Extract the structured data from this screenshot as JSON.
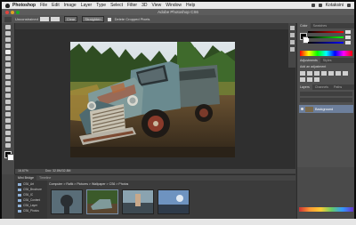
{
  "menubar": {
    "items": [
      "Photoshop",
      "File",
      "Edit",
      "Image",
      "Layer",
      "Type",
      "Select",
      "Filter",
      "3D",
      "View",
      "Window",
      "Help"
    ],
    "user": "Kotaksini"
  },
  "title_bar": "Adobe Photoshop CS6",
  "options_bar": {
    "ratio_label": "Unconstrained",
    "clear": "Clear",
    "straighten": "Straighten",
    "delete_cropped": "Delete Cropped Pixels"
  },
  "document": {
    "tab": "Brightness.psd @ 16.7% (RGB/8)"
  },
  "status": {
    "zoom": "16.67%",
    "doc": "Doc: 32.8M/32.8M"
  },
  "panels": {
    "color_tabs": [
      "Color",
      "Swatches"
    ],
    "adj_tabs": [
      "Adjustments",
      "Styles"
    ],
    "adj_label": "Add an adjustment",
    "layer_tabs": [
      "Layers",
      "Channels",
      "Paths"
    ],
    "layer_name": "Background"
  },
  "bottom": {
    "tabs": [
      "Mini Bridge",
      "Timeline"
    ],
    "path": "Computer > Rafik > Pictures > Wallpaper > CS6 > Photos",
    "folders": [
      "CS6_Art",
      "CS6_Brochure",
      "CS6_IC",
      "CS6_Content",
      "CS6_Layer",
      "CS6_Photos"
    ]
  }
}
